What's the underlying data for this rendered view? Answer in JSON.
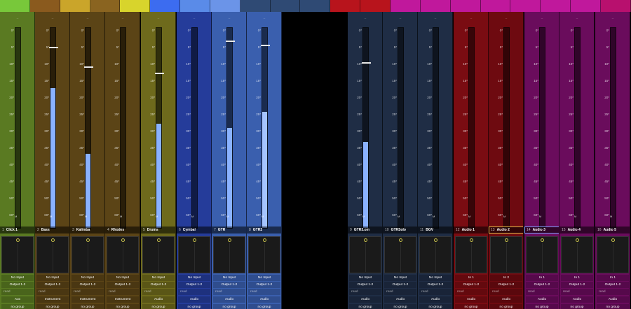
{
  "topbar_colors": [
    "#78c83a",
    "#8a5a1e",
    "#caa52a",
    "#8a6420",
    "#d8d42c",
    "#3c6cf0",
    "#5a8be8",
    "#6b94e8",
    "#2f4a74",
    "#2f4a74",
    "#2f4a74",
    "#b8141c",
    "#b8141c",
    "#c0189c",
    "#c0189c",
    "#c0189c",
    "#c0189c",
    "#c0189c",
    "#c0189c",
    "#c0189c",
    "#b8106e"
  ],
  "scale_ticks": [
    "0*",
    "5*",
    "10*",
    "15*",
    "20*",
    "25*",
    "30*",
    "35*",
    "40*",
    "45*",
    "50*",
    "60*"
  ],
  "strips": [
    {
      "num": "1",
      "name": "Click 1",
      "color": "#5a7a22",
      "input": "No Input",
      "output": "Output 1-2",
      "mode": "read",
      "type": "Aux",
      "group": "no group",
      "meter": 0,
      "fader": 0,
      "fill": "#8fb6ff",
      "selected": ""
    },
    {
      "num": "2",
      "name": "Bass",
      "color": "#5b4416",
      "input": "No Input",
      "output": "Output 1-2",
      "mode": "read",
      "type": "Instrument",
      "group": "no group",
      "meter": 0.7,
      "fader": 0.9,
      "fill": "#8ab2ff",
      "selected": ""
    },
    {
      "num": "3",
      "name": "Kalimba",
      "color": "#5b4416",
      "input": "No Input",
      "output": "Output 1-2",
      "mode": "read",
      "type": "Instrument",
      "group": "no group",
      "meter": 0.37,
      "fader": 0.8,
      "fill": "#8ab2ff",
      "selected": ""
    },
    {
      "num": "4",
      "name": "Rhodes",
      "color": "#5b4416",
      "input": "No Input",
      "output": "Output 1-2",
      "mode": "read",
      "type": "Instrument",
      "group": "no group",
      "meter": 0,
      "fader": 0,
      "fill": "#8ab2ff",
      "selected": ""
    },
    {
      "num": "5",
      "name": "Drums",
      "color": "#6e6a1c",
      "input": "No Input",
      "output": "Output 1-2",
      "mode": "read",
      "type": "Audio",
      "group": "no group",
      "meter": 0.52,
      "fader": 0.77,
      "fill": "#8ab2ff",
      "selected": ""
    },
    {
      "num": "6",
      "name": "Cymbal",
      "color": "#253c9a",
      "input": "No Input",
      "output": "Output 1-2",
      "mode": "read",
      "type": "Audio",
      "group": "no group",
      "meter": 0,
      "fader": 0,
      "fill": "#8ab2ff",
      "selected": ""
    },
    {
      "num": "7",
      "name": "GTR",
      "color": "#3a5fae",
      "input": "No Input",
      "output": "Output 1-2",
      "mode": "read",
      "type": "Audio",
      "group": "no group",
      "meter": 0.5,
      "fader": 0.93,
      "fill": "#8ab2ff",
      "selected": ""
    },
    {
      "num": "8",
      "name": "GTR2",
      "color": "#3a5fae",
      "input": "No Input",
      "output": "Output 1-2",
      "mode": "read",
      "type": "Audio",
      "group": "no group",
      "meter": 0.58,
      "fader": 0.91,
      "fill": "#a5c4ff",
      "selected": ""
    },
    {
      "num": "9",
      "name": "GTR3.om",
      "color": "#1f2d45",
      "input": "No Input",
      "output": "Output 1-2",
      "mode": "read",
      "type": "Audio",
      "group": "no group",
      "meter": 0.43,
      "fader": 0.82,
      "fill": "#8ab2ff",
      "selected": ""
    },
    {
      "num": "10",
      "name": "GTRSolo",
      "color": "#1f2d45",
      "input": "No Input",
      "output": "Output 1-2",
      "mode": "read",
      "type": "Audio",
      "group": "no group",
      "meter": 0,
      "fader": 0,
      "fill": "#8ab2ff",
      "selected": ""
    },
    {
      "num": "11",
      "name": "BGV",
      "color": "#1f2d45",
      "input": "No Input",
      "output": "Output 1-2",
      "mode": "read",
      "type": "Audio",
      "group": "no group",
      "meter": 0,
      "fader": 0,
      "fill": "#8ab2ff",
      "selected": ""
    },
    {
      "num": "12",
      "name": "Audio 1",
      "color": "#7a0c12",
      "input": "In 1",
      "output": "Output 1-2",
      "mode": "read",
      "type": "Audio",
      "group": "no group",
      "meter": 0,
      "fader": 0,
      "fill": "#8ab2ff",
      "selected": ""
    },
    {
      "num": "13",
      "name": "Audio 2",
      "color": "#6e0a10",
      "input": "In 2",
      "output": "Output 1-2",
      "mode": "read",
      "type": "Audio",
      "group": "no group",
      "meter": 0,
      "fader": 0,
      "fill": "#8ab2ff",
      "selected": "sel"
    },
    {
      "num": "14",
      "name": "Audio 3",
      "color": "#6a0c5c",
      "input": "In 1",
      "output": "Output 1-2",
      "mode": "read",
      "type": "Audio",
      "group": "no group",
      "meter": 0,
      "fader": 0,
      "fill": "#8ab2ff",
      "selected": "sel-blue"
    },
    {
      "num": "15",
      "name": "Audio 4",
      "color": "#6a0c5c",
      "input": "In 1",
      "output": "Output 1-2",
      "mode": "read",
      "type": "Audio",
      "group": "no group",
      "meter": 0,
      "fader": 0,
      "fill": "#8ab2ff",
      "selected": ""
    },
    {
      "num": "16",
      "name": "Audio 5",
      "color": "#6a0c5c",
      "input": "In 1",
      "output": "Output 1-2",
      "mode": "read",
      "type": "Audio",
      "group": "no group",
      "meter": 0,
      "fader": 0,
      "fill": "#8ab2ff",
      "selected": ""
    }
  ]
}
